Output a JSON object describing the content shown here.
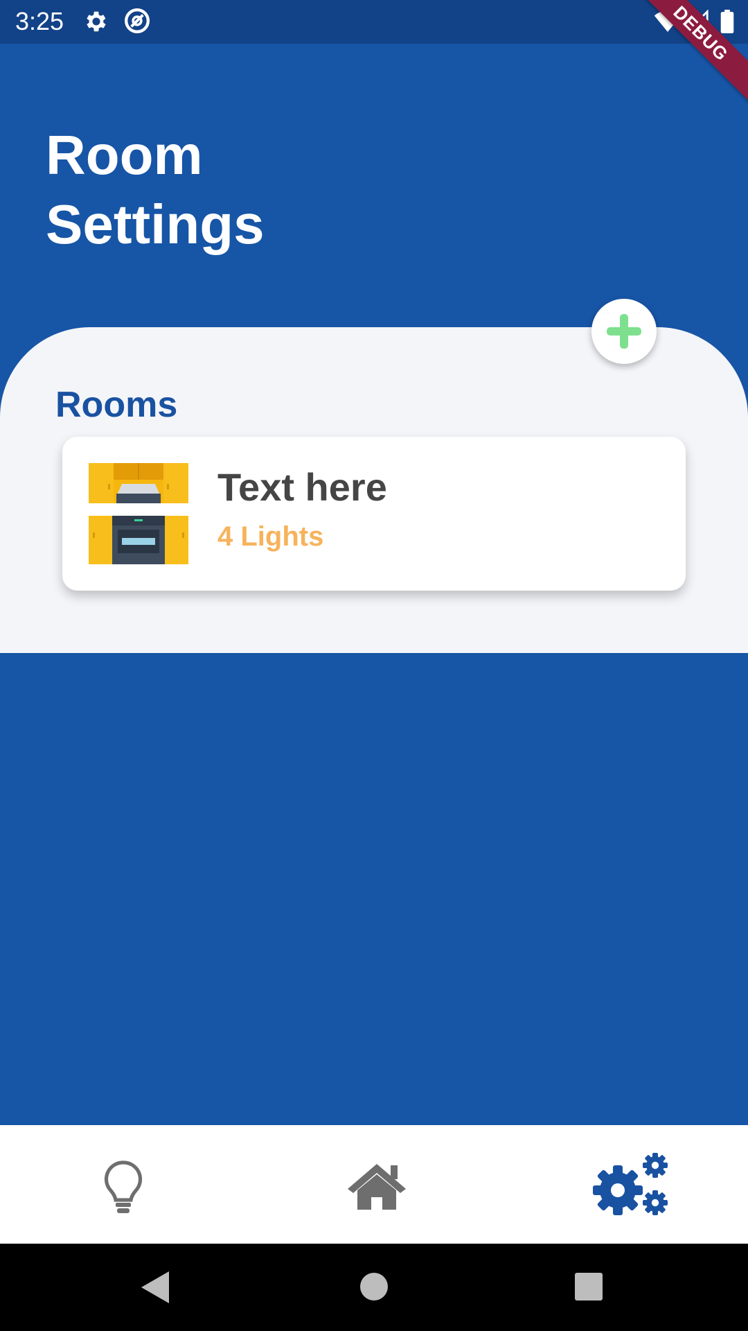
{
  "status_bar": {
    "time": "3:25",
    "icons": [
      "gear-icon",
      "at-sign-icon",
      "wifi-icon",
      "cell-signal-icon",
      "battery-icon"
    ],
    "debug_label": "DEBUG"
  },
  "header": {
    "title": "Room\nSettings"
  },
  "rooms_section": {
    "heading": "Rooms",
    "rooms": [
      {
        "name": "Text here",
        "lights": "4 Lights",
        "image": "kitchen-illustration"
      }
    ],
    "add_button_icon": "plus-icon"
  },
  "bottom_nav": {
    "items": [
      {
        "icon": "lightbulb-icon",
        "active": false
      },
      {
        "icon": "home-icon",
        "active": false
      },
      {
        "icon": "settings-gears-icon",
        "active": true
      }
    ]
  },
  "system_nav": {
    "items": [
      "back-icon",
      "home-circle-icon",
      "recents-icon"
    ]
  },
  "colors": {
    "primary_blue": "#1755a6",
    "status_bar": "#124287",
    "panel_bg": "#f4f5f9",
    "accent_green": "#7ee08f",
    "lights_orange": "#f6b35c",
    "room_title": "#454545",
    "nav_inactive": "#6e6e6e",
    "nav_active": "#1a52a2",
    "debug_ribbon": "#8c1c3f"
  }
}
